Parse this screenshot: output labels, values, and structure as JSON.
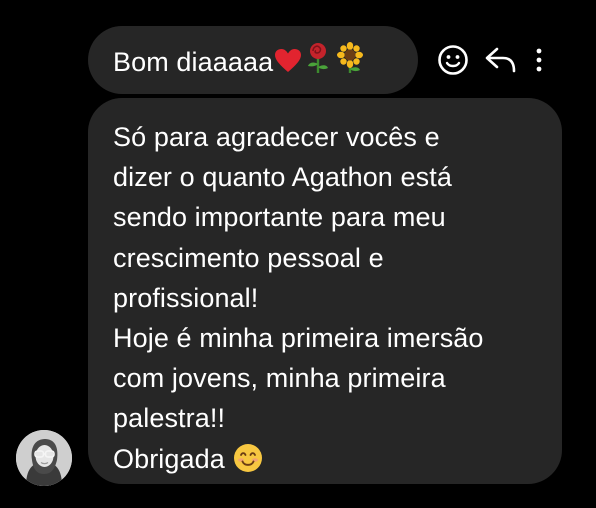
{
  "chat": {
    "message_1": {
      "text": "Bom diaaaaa",
      "emojis": [
        "heart-icon",
        "rose-icon",
        "sunflower-icon"
      ]
    },
    "message_2": {
      "lines": [
        "Só para agradecer vocês e",
        "dizer o quanto Agathon está",
        "sendo importante para meu",
        "crescimento pessoal e",
        "profissional!",
        "Hoje é minha primeira imersão",
        "com jovens, minha primeira",
        "palestra!!",
        "Obrigada"
      ],
      "trailing_emoji": "smiling-face-icon"
    },
    "actions": [
      "emoji-react-icon",
      "reply-icon",
      "more-options-icon"
    ],
    "sender_avatar": "avatar"
  },
  "colors": {
    "background": "#000000",
    "bubble": "#262626",
    "text": "#ffffff",
    "heart": "#e2242f",
    "rose": "#c4232b",
    "sunflower": "#f6b91d",
    "smile_face": "#f7c741"
  }
}
